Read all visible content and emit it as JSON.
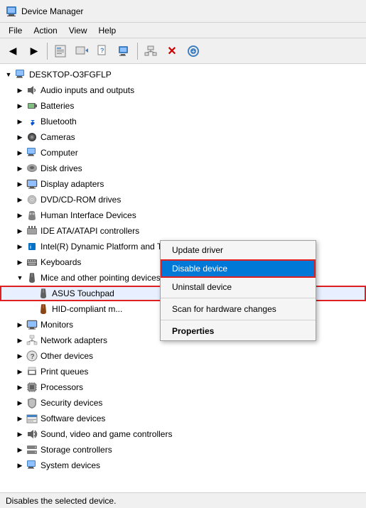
{
  "window": {
    "title": "Device Manager",
    "title_icon": "🖥"
  },
  "menu": {
    "items": [
      "File",
      "Action",
      "View",
      "Help"
    ]
  },
  "toolbar": {
    "buttons": [
      {
        "name": "back",
        "icon": "◀",
        "label": "Back"
      },
      {
        "name": "forward",
        "icon": "▶",
        "label": "Forward"
      },
      {
        "name": "properties",
        "icon": "🗐",
        "label": "Properties"
      },
      {
        "name": "update-driver",
        "icon": "💾",
        "label": "Update driver"
      },
      {
        "name": "help",
        "icon": "❓",
        "label": "Help"
      },
      {
        "name": "scan",
        "icon": "🖥",
        "label": "Scan"
      },
      {
        "name": "network",
        "icon": "🌐",
        "label": "Network"
      },
      {
        "name": "delete",
        "icon": "✕",
        "label": "Delete"
      },
      {
        "name": "refresh",
        "icon": "⊕",
        "label": "Refresh"
      }
    ]
  },
  "tree": {
    "computer_name": "DESKTOP-O3FGFLP",
    "items": [
      {
        "id": "audio",
        "label": "Audio inputs and outputs",
        "icon": "🔊",
        "level": 1,
        "expandable": true,
        "expanded": false
      },
      {
        "id": "batteries",
        "label": "Batteries",
        "icon": "🔋",
        "level": 1,
        "expandable": true,
        "expanded": false
      },
      {
        "id": "bluetooth",
        "label": "Bluetooth",
        "icon": "🔵",
        "level": 1,
        "expandable": true,
        "expanded": false
      },
      {
        "id": "cameras",
        "label": "Cameras",
        "icon": "📷",
        "level": 1,
        "expandable": true,
        "expanded": false
      },
      {
        "id": "computer",
        "label": "Computer",
        "icon": "🖥",
        "level": 1,
        "expandable": true,
        "expanded": false
      },
      {
        "id": "disk",
        "label": "Disk drives",
        "icon": "💽",
        "level": 1,
        "expandable": true,
        "expanded": false
      },
      {
        "id": "display",
        "label": "Display adapters",
        "icon": "🖵",
        "level": 1,
        "expandable": true,
        "expanded": false
      },
      {
        "id": "dvd",
        "label": "DVD/CD-ROM drives",
        "icon": "💿",
        "level": 1,
        "expandable": true,
        "expanded": false
      },
      {
        "id": "hid",
        "label": "Human Interface Devices",
        "icon": "🖱",
        "level": 1,
        "expandable": true,
        "expanded": false
      },
      {
        "id": "ide",
        "label": "IDE ATA/ATAPI controllers",
        "icon": "🔌",
        "level": 1,
        "expandable": true,
        "expanded": false
      },
      {
        "id": "intel",
        "label": "Intel(R) Dynamic Platform and Thermal Framework",
        "icon": "⚡",
        "level": 1,
        "expandable": true,
        "expanded": false
      },
      {
        "id": "keyboards",
        "label": "Keyboards",
        "icon": "⌨",
        "level": 1,
        "expandable": true,
        "expanded": false
      },
      {
        "id": "mice",
        "label": "Mice and other pointing devices",
        "icon": "🖱",
        "level": 1,
        "expandable": true,
        "expanded": true
      },
      {
        "id": "asus",
        "label": "ASUS Touchpad",
        "icon": "🖱",
        "level": 2,
        "expandable": false,
        "selected": true,
        "asus": true
      },
      {
        "id": "hid-compliant",
        "label": "HID-compliant m...",
        "icon": "🖱",
        "level": 2,
        "expandable": false
      },
      {
        "id": "monitors",
        "label": "Monitors",
        "icon": "🖵",
        "level": 1,
        "expandable": true,
        "expanded": false
      },
      {
        "id": "network",
        "label": "Network adapters",
        "icon": "🌐",
        "level": 1,
        "expandable": true,
        "expanded": false
      },
      {
        "id": "other",
        "label": "Other devices",
        "icon": "❓",
        "level": 1,
        "expandable": true,
        "expanded": false
      },
      {
        "id": "print",
        "label": "Print queues",
        "icon": "🖨",
        "level": 1,
        "expandable": true,
        "expanded": false
      },
      {
        "id": "processors",
        "label": "Processors",
        "icon": "🔲",
        "level": 1,
        "expandable": true,
        "expanded": false
      },
      {
        "id": "security",
        "label": "Security devices",
        "icon": "🔒",
        "level": 1,
        "expandable": true,
        "expanded": false
      },
      {
        "id": "software",
        "label": "Software devices",
        "icon": "📦",
        "level": 1,
        "expandable": true,
        "expanded": false
      },
      {
        "id": "sound",
        "label": "Sound, video and game controllers",
        "icon": "🔊",
        "level": 1,
        "expandable": true,
        "expanded": false
      },
      {
        "id": "storage",
        "label": "Storage controllers",
        "icon": "💾",
        "level": 1,
        "expandable": true,
        "expanded": false
      },
      {
        "id": "system",
        "label": "System devices",
        "icon": "🖥",
        "level": 1,
        "expandable": true,
        "expanded": false
      }
    ]
  },
  "context_menu": {
    "items": [
      {
        "id": "update-driver",
        "label": "Update driver",
        "bold": false,
        "active": false,
        "separator_after": false
      },
      {
        "id": "disable-device",
        "label": "Disable device",
        "bold": false,
        "active": true,
        "separator_after": false
      },
      {
        "id": "uninstall-device",
        "label": "Uninstall device",
        "bold": false,
        "active": false,
        "separator_after": true
      },
      {
        "id": "scan-hardware",
        "label": "Scan for hardware changes",
        "bold": false,
        "active": false,
        "separator_after": true
      },
      {
        "id": "properties",
        "label": "Properties",
        "bold": true,
        "active": false,
        "separator_after": false
      }
    ]
  },
  "status_bar": {
    "text": "Disables the selected device."
  }
}
